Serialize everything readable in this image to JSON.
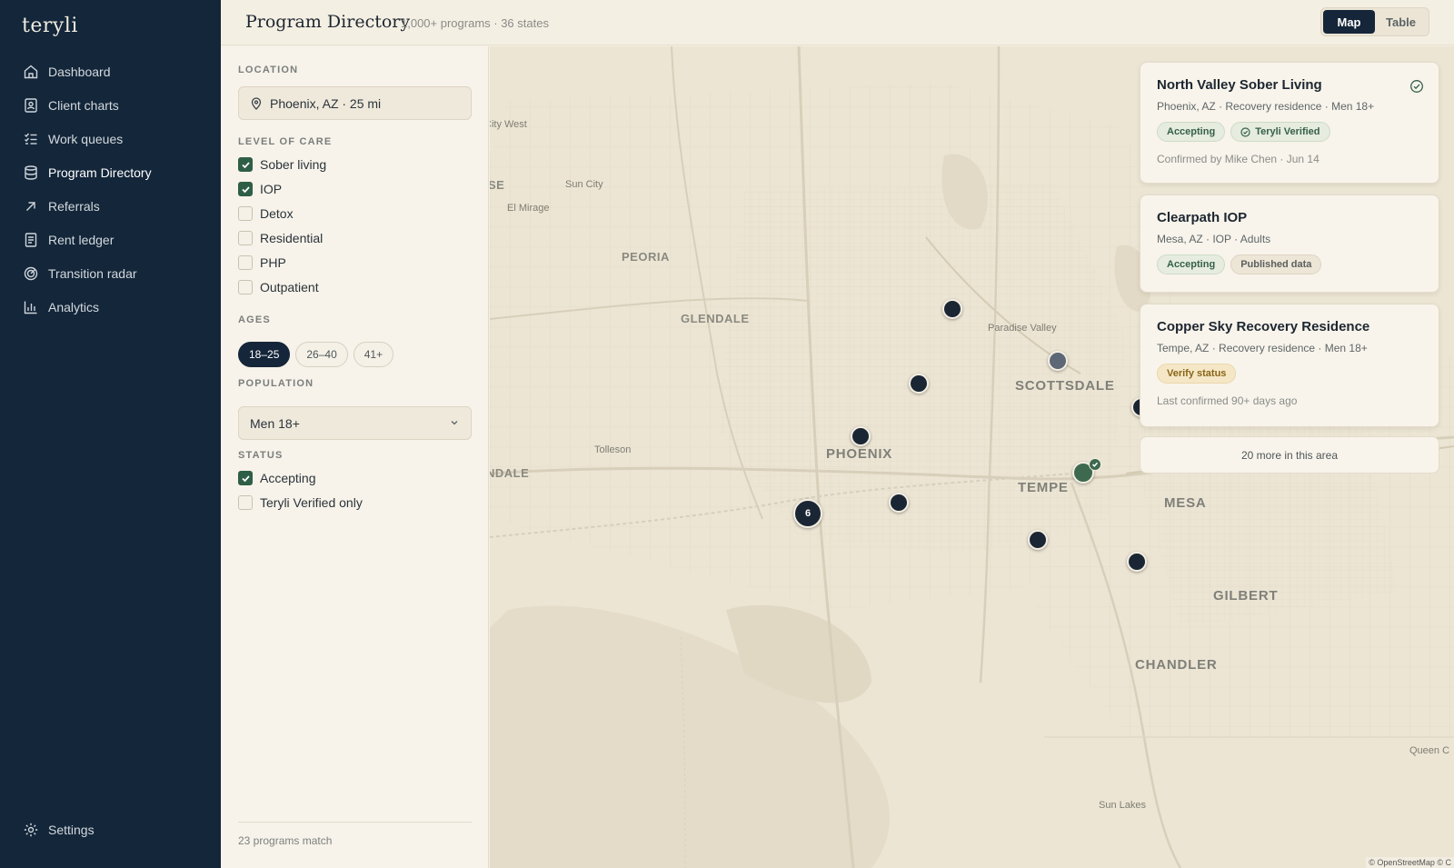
{
  "app": {
    "logo": "teryli"
  },
  "nav": {
    "items": [
      {
        "label": "Dashboard",
        "icon": "home-icon"
      },
      {
        "label": "Client charts",
        "icon": "client-chart-icon"
      },
      {
        "label": "Work queues",
        "icon": "checklist-icon"
      },
      {
        "label": "Program Directory",
        "icon": "database-icon",
        "active": true
      },
      {
        "label": "Referrals",
        "icon": "arrow-up-right-icon"
      },
      {
        "label": "Rent ledger",
        "icon": "ledger-icon"
      },
      {
        "label": "Transition radar",
        "icon": "radar-icon"
      },
      {
        "label": "Analytics",
        "icon": "bar-chart-icon"
      }
    ],
    "settings": "Settings"
  },
  "header": {
    "title": "Program Directory",
    "subtitle": "1,000+ programs · 36 states",
    "view_map": "Map",
    "view_table": "Table",
    "active_view": "Map"
  },
  "filters": {
    "location_label": "LOCATION",
    "location_value": "Phoenix, AZ · 25 mi",
    "care_label": "LEVEL OF CARE",
    "care": [
      {
        "label": "Sober living",
        "checked": true
      },
      {
        "label": "IOP",
        "checked": true
      },
      {
        "label": "Detox",
        "checked": false
      },
      {
        "label": "Residential",
        "checked": false
      },
      {
        "label": "PHP",
        "checked": false
      },
      {
        "label": "Outpatient",
        "checked": false
      }
    ],
    "ages_label": "AGES",
    "ages": [
      {
        "label": "18–25",
        "selected": true
      },
      {
        "label": "26–40",
        "selected": false
      },
      {
        "label": "41+",
        "selected": false
      }
    ],
    "population_label": "POPULATION",
    "population_value": "Men 18+",
    "status_label": "STATUS",
    "status": [
      {
        "label": "Accepting",
        "checked": true
      },
      {
        "label": "Teryli Verified only",
        "checked": false
      }
    ],
    "match_count": "23 programs match"
  },
  "map": {
    "places": {
      "city_west": "City West",
      "se": "SE",
      "sun_city": "Sun City",
      "el_mirage": "El Mirage",
      "peoria": "PEORIA",
      "glendale": "GLENDALE",
      "paradise_valley": "Paradise Valley",
      "scottsdale": "SCOTTSDALE",
      "phoenix": "PHOENIX",
      "tolleson": "Tolleson",
      "ndale": "NDALE",
      "tempe": "TEMPE",
      "mesa": "MESA",
      "gilbert": "GILBERT",
      "chandler": "CHANDLER",
      "queen_c": "Queen C",
      "sun_lakes": "Sun Lakes"
    },
    "cluster_count": "6",
    "attribution": "© OpenStreetMap © C"
  },
  "colors": {
    "sidebar": "#13263a",
    "accent_green": "#2f5e46",
    "map_bg": "#ece5d4",
    "pin": "#1b2634"
  },
  "results": [
    {
      "name": "North Valley Sober Living",
      "meta": "Phoenix, AZ · Recovery residence · Men 18+",
      "badges": [
        "Accepting",
        "Teryli Verified"
      ],
      "footer": "Confirmed by Mike Chen · Jun 14"
    },
    {
      "name": "Clearpath IOP",
      "meta": "Mesa, AZ · IOP · Adults",
      "badges": [
        "Accepting",
        "Published data"
      ]
    },
    {
      "name": "Copper Sky Recovery Residence",
      "meta": "Tempe, AZ · Recovery residence · Men 18+",
      "badges": [
        "Verify status"
      ],
      "footer": "Last confirmed 90+ days ago"
    }
  ],
  "more_results": "20 more in this area"
}
